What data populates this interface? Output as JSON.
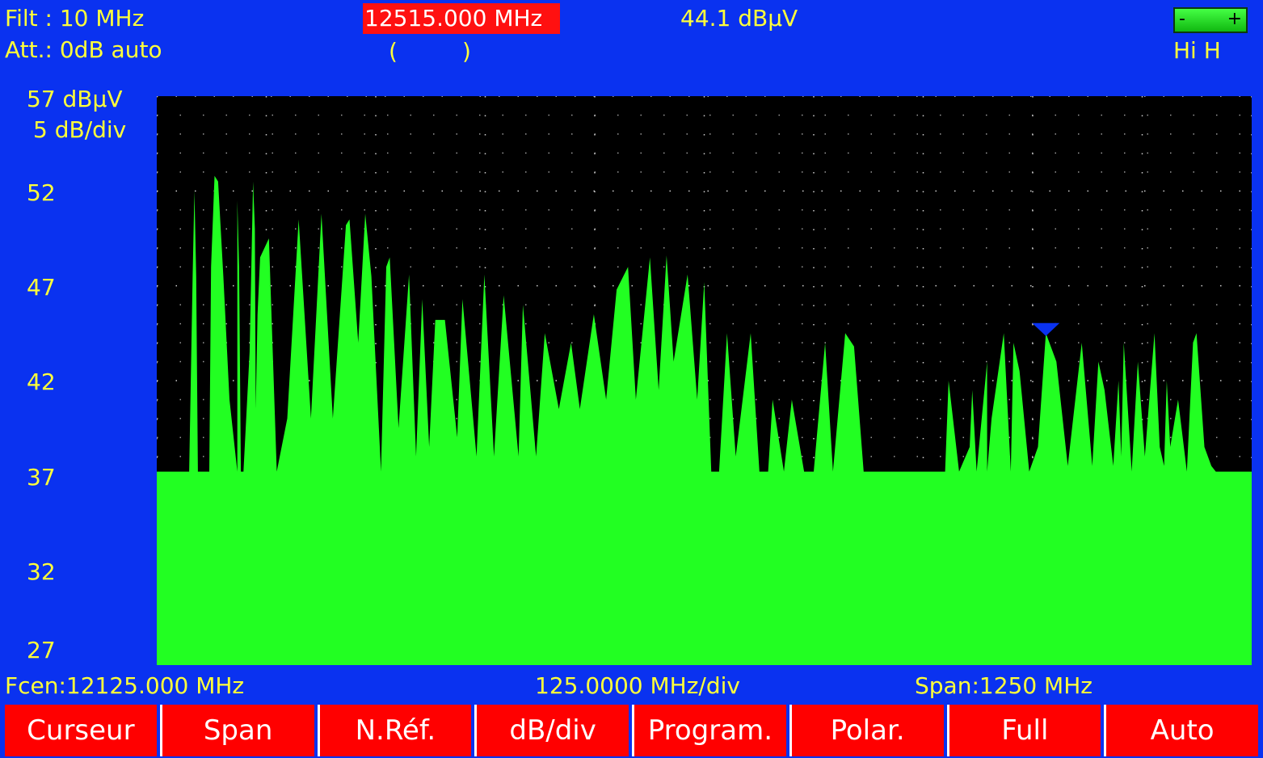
{
  "header": {
    "filter": "Filt : 10 MHz",
    "attenuation": "Att.:  0dB auto",
    "cursor_frequency": "12515.000 MHz",
    "cursor_level": "44.1 dBµV",
    "paren_left": "(",
    "paren_right": ")",
    "battery_minus": "-",
    "battery_plus": "+",
    "polarization": "Hi H"
  },
  "y_axis": {
    "reference": "57 dBµV",
    "scale": "5 dB/div",
    "ticks": [
      "52",
      "47",
      "42",
      "37",
      "32",
      "27"
    ]
  },
  "footer": {
    "center_frequency": "Fcen:12125.000  MHz",
    "per_division": "125.0000 MHz/div",
    "span": "Span:1250 MHz"
  },
  "softkeys": [
    "Curseur",
    "Span",
    "N.Réf.",
    "dB/div",
    "Program.",
    "Polar.",
    "Full",
    "Auto"
  ],
  "colors": {
    "background": "#0a32f0",
    "plot_background": "#000000",
    "trace": "#22ff22",
    "text": "#ffff3a",
    "highlight": "#ff1010",
    "marker": "#0a32f0"
  },
  "chart_data": {
    "type": "area",
    "ylim": [
      27,
      57
    ],
    "xlim": [
      11500,
      12750
    ],
    "y_unit": "dBµV",
    "x_unit": "MHz",
    "cursor": {
      "x": 12515,
      "y": 44.1
    },
    "x": [
      11500,
      11537,
      11541,
      11543,
      11545,
      11547,
      11560,
      11562,
      11566,
      11570,
      11576,
      11583,
      11592,
      11592,
      11594,
      11596,
      11599,
      11606,
      11610,
      11612,
      11613,
      11615,
      11618,
      11628,
      11637,
      11649,
      11662,
      11676,
      11688,
      11701,
      11716,
      11720,
      11730,
      11738,
      11745,
      11756,
      11762,
      11766,
      11776,
      11788,
      11796,
      11803,
      11811,
      11818,
      11829,
      11843,
      11849,
      11865,
      11874,
      11885,
      11896,
      11913,
      11918,
      11933,
      11943,
      11959,
      11973,
      11983,
      11999,
      12013,
      12025,
      12038,
      12047,
      12063,
      12073,
      12082,
      12090,
      12106,
      12117,
      12125,
      12133,
      12142,
      12151,
      12161,
      12178,
      12188,
      12198,
      12203,
      12216,
      12225,
      12239,
      12250,
      12263,
      12272,
      12286,
      12296,
      12307,
      12318,
      12326,
      12348,
      12365,
      12386,
      12400,
      12404,
      12416,
      12428,
      12431,
      12436,
      12448,
      12448,
      12453,
      12467,
      12475,
      12478,
      12485,
      12496,
      12506,
      12515,
      12527,
      12540,
      12556,
      12568,
      12575,
      12582,
      12592,
      12598,
      12601,
      12604,
      12613,
      12620,
      12628,
      12639,
      12645,
      12650,
      12653,
      12657,
      12666,
      12676,
      12683,
      12687,
      12696,
      12704,
      12709,
      12721,
      12734,
      12750
    ],
    "y": [
      37.2,
      37.2,
      47.5,
      52.0,
      47.5,
      37.2,
      37.2,
      48.0,
      52.8,
      52.5,
      47.5,
      41.0,
      37.2,
      51.5,
      48.0,
      37.2,
      37.2,
      43.5,
      52.5,
      50.0,
      40.5,
      45.5,
      48.5,
      49.5,
      37.2,
      40.0,
      50.5,
      40.0,
      50.8,
      40.0,
      50.2,
      50.5,
      44.0,
      50.8,
      47.5,
      37.2,
      48.0,
      48.5,
      39.5,
      47.6,
      38.0,
      46.3,
      38.5,
      45.2,
      45.2,
      39.0,
      46.3,
      38.0,
      47.6,
      38.0,
      46.5,
      38.0,
      46.0,
      38.0,
      44.5,
      40.5,
      44.0,
      40.5,
      45.5,
      41.0,
      46.8,
      48.0,
      41.0,
      48.5,
      41.5,
      48.6,
      43.0,
      47.6,
      41.0,
      47.2,
      37.2,
      37.2,
      44.5,
      38.0,
      44.5,
      37.2,
      37.2,
      41.0,
      37.2,
      41.0,
      37.2,
      37.2,
      44.0,
      37.2,
      44.5,
      43.8,
      37.2,
      37.2,
      37.2,
      37.2,
      37.2,
      37.2,
      37.2,
      42.0,
      37.2,
      38.5,
      41.5,
      37.2,
      43.0,
      37.2,
      40.0,
      44.5,
      37.2,
      44.0,
      42.5,
      37.2,
      38.5,
      44.5,
      43.0,
      37.5,
      44.0,
      37.5,
      43.0,
      41.5,
      37.5,
      42.0,
      38.0,
      44.0,
      37.2,
      43.0,
      38.0,
      44.5,
      38.5,
      37.5,
      42.0,
      38.5,
      41.0,
      37.2,
      44.0,
      44.5,
      38.5,
      37.5,
      37.2,
      37.2,
      37.2,
      37.2
    ]
  }
}
